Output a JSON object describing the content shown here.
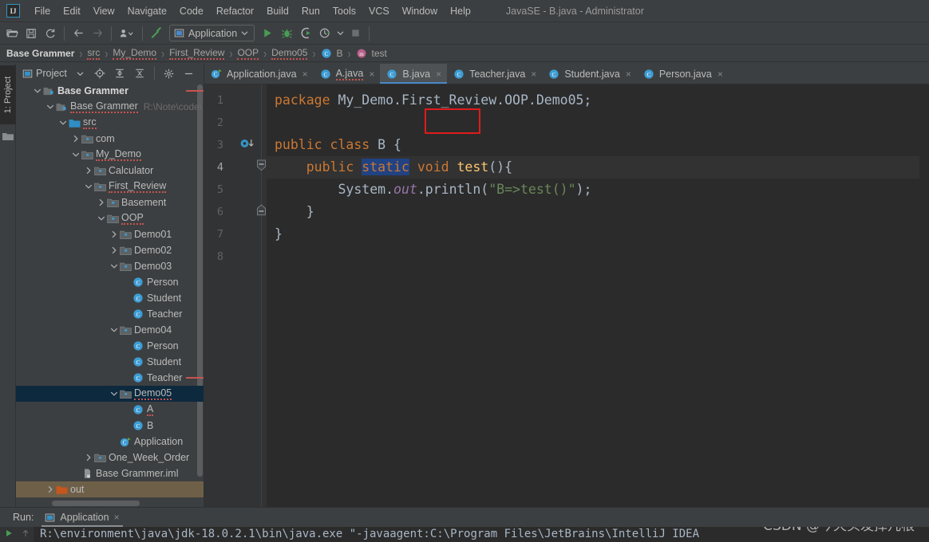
{
  "window": {
    "title": "JavaSE - B.java - Administrator",
    "logo_text": "IJ"
  },
  "menu": {
    "items": [
      {
        "label": "File"
      },
      {
        "label": "Edit"
      },
      {
        "label": "View"
      },
      {
        "label": "Navigate"
      },
      {
        "label": "Code"
      },
      {
        "label": "Refactor"
      },
      {
        "label": "Build"
      },
      {
        "label": "Run"
      },
      {
        "label": "Tools"
      },
      {
        "label": "VCS"
      },
      {
        "label": "Window"
      },
      {
        "label": "Help"
      }
    ]
  },
  "toolbar": {
    "icons": [
      "open-folder-icon",
      "save-icon",
      "sync-icon",
      "back-arrow-icon",
      "forward-arrow-icon",
      "profile-icon",
      "build-hammer-icon"
    ],
    "run_config": "Application",
    "run_icon": "run-icon",
    "debug_icon": "debug-icon",
    "coverage_icon": "run-with-coverage-icon",
    "profiler_icon": "profiler-icon",
    "stop_icon": "stop-icon"
  },
  "breadcrumb": {
    "items": [
      {
        "label": "Base Grammer",
        "style": "bold",
        "icon": ""
      },
      {
        "label": "src",
        "style": "squiggle",
        "icon": ""
      },
      {
        "label": "My_Demo",
        "style": "squiggle",
        "icon": ""
      },
      {
        "label": "First_Review",
        "style": "squiggle",
        "icon": ""
      },
      {
        "label": "OOP",
        "style": "squiggle",
        "icon": ""
      },
      {
        "label": "Demo05",
        "style": "squiggle",
        "icon": ""
      },
      {
        "label": "B",
        "style": "plain",
        "icon": "class-icon"
      },
      {
        "label": "test",
        "style": "plain",
        "icon": "method-icon"
      }
    ],
    "separator": "›"
  },
  "project_panel": {
    "strip_tab": "1: Project",
    "title": "Project",
    "dropdown_icon": "chevron-down-icon",
    "locate_icon": "locate-target-icon",
    "expand_icon": "expand-all-icon",
    "collapse_icon": "collapse-all-icon",
    "settings_icon": "gear-icon",
    "hide_icon": "minimize-icon",
    "tree": [
      {
        "label": "Base Grammer",
        "indent": 1,
        "twist": "down",
        "icon": "module-icon",
        "style": "bold",
        "path": "",
        "state": "normal"
      },
      {
        "label": "Base Grammer",
        "indent": 2,
        "twist": "down",
        "icon": "module-icon",
        "style": "sq",
        "path": "R:\\Note\\code\\",
        "state": "normal"
      },
      {
        "label": "src",
        "indent": 3,
        "twist": "down",
        "icon": "src-folder-icon",
        "style": "sq",
        "path": "",
        "state": "normal"
      },
      {
        "label": "com",
        "indent": 4,
        "twist": "right",
        "icon": "package-icon",
        "style": "normal",
        "path": "",
        "state": "normal"
      },
      {
        "label": "My_Demo",
        "indent": 4,
        "twist": "down",
        "icon": "package-icon",
        "style": "sq",
        "path": "",
        "state": "normal"
      },
      {
        "label": "Calculator",
        "indent": 5,
        "twist": "right",
        "icon": "package-icon",
        "style": "normal",
        "path": "",
        "state": "normal"
      },
      {
        "label": "First_Review",
        "indent": 5,
        "twist": "down",
        "icon": "package-icon",
        "style": "sq",
        "path": "",
        "state": "normal"
      },
      {
        "label": "Basement",
        "indent": 6,
        "twist": "right",
        "icon": "package-icon",
        "style": "normal",
        "path": "",
        "state": "normal"
      },
      {
        "label": "OOP",
        "indent": 6,
        "twist": "down",
        "icon": "package-icon",
        "style": "sq",
        "path": "",
        "state": "normal"
      },
      {
        "label": "Demo01",
        "indent": 7,
        "twist": "right",
        "icon": "package-icon",
        "style": "normal",
        "path": "",
        "state": "normal"
      },
      {
        "label": "Demo02",
        "indent": 7,
        "twist": "right",
        "icon": "package-icon",
        "style": "normal",
        "path": "",
        "state": "normal"
      },
      {
        "label": "Demo03",
        "indent": 7,
        "twist": "down",
        "icon": "package-icon",
        "style": "normal",
        "path": "",
        "state": "normal"
      },
      {
        "label": "Person",
        "indent": 8,
        "twist": "none",
        "icon": "class-icon",
        "style": "normal",
        "path": "",
        "state": "normal"
      },
      {
        "label": "Student",
        "indent": 8,
        "twist": "none",
        "icon": "class-icon",
        "style": "normal",
        "path": "",
        "state": "normal"
      },
      {
        "label": "Teacher",
        "indent": 8,
        "twist": "none",
        "icon": "class-icon",
        "style": "normal",
        "path": "",
        "state": "normal"
      },
      {
        "label": "Demo04",
        "indent": 7,
        "twist": "down",
        "icon": "package-icon",
        "style": "normal",
        "path": "",
        "state": "normal"
      },
      {
        "label": "Person",
        "indent": 8,
        "twist": "none",
        "icon": "class-icon",
        "style": "normal",
        "path": "",
        "state": "normal"
      },
      {
        "label": "Student",
        "indent": 8,
        "twist": "none",
        "icon": "class-icon",
        "style": "normal",
        "path": "",
        "state": "normal"
      },
      {
        "label": "Teacher",
        "indent": 8,
        "twist": "none",
        "icon": "class-icon",
        "style": "normal",
        "path": "",
        "state": "marker"
      },
      {
        "label": "Demo05",
        "indent": 7,
        "twist": "down",
        "icon": "package-icon",
        "style": "sq",
        "path": "",
        "state": "selected"
      },
      {
        "label": "A",
        "indent": 8,
        "twist": "none",
        "icon": "class-icon",
        "style": "sq",
        "path": "",
        "state": "normal"
      },
      {
        "label": "B",
        "indent": 8,
        "twist": "none",
        "icon": "class-icon",
        "style": "normal",
        "path": "",
        "state": "normal"
      },
      {
        "label": "Application",
        "indent": 7,
        "twist": "none",
        "icon": "runnable-class-icon",
        "style": "normal",
        "path": "",
        "state": "normal"
      },
      {
        "label": "One_Week_Order",
        "indent": 5,
        "twist": "right",
        "icon": "package-icon",
        "style": "normal",
        "path": "",
        "state": "normal"
      },
      {
        "label": "Base Grammer.iml",
        "indent": 4,
        "twist": "none",
        "icon": "iml-file-icon",
        "style": "normal",
        "path": "",
        "state": "normal"
      },
      {
        "label": "out",
        "indent": 2,
        "twist": "right",
        "icon": "out-folder-icon",
        "style": "normal",
        "path": "",
        "state": "out-selected"
      }
    ]
  },
  "editor": {
    "tabs": [
      {
        "label": "Application.java",
        "icon": "runnable-class-icon",
        "active": false,
        "squiggle": false,
        "close": "×"
      },
      {
        "label": "A.java",
        "icon": "class-icon",
        "active": false,
        "squiggle": true,
        "close": "×"
      },
      {
        "label": "B.java",
        "icon": "class-icon",
        "active": true,
        "squiggle": false,
        "close": "×"
      },
      {
        "label": "Teacher.java",
        "icon": "class-icon",
        "active": false,
        "squiggle": false,
        "close": "×"
      },
      {
        "label": "Student.java",
        "icon": "class-icon",
        "active": false,
        "squiggle": false,
        "close": "×"
      },
      {
        "label": "Person.java",
        "icon": "class-icon",
        "active": false,
        "squiggle": false,
        "close": "×"
      }
    ],
    "line_numbers": [
      "1",
      "2",
      "3",
      "4",
      "5",
      "6",
      "7",
      "8"
    ],
    "current_line": "4",
    "code_lines": [
      {
        "n": "1",
        "tokens": [
          {
            "t": "package ",
            "c": "kw"
          },
          {
            "t": "My_Demo.First_Review.OOP.Demo05;",
            "c": "plain"
          }
        ]
      },
      {
        "n": "2",
        "tokens": []
      },
      {
        "n": "3",
        "tokens": [
          {
            "t": "public class ",
            "c": "kw"
          },
          {
            "t": "B {",
            "c": "plain"
          }
        ]
      },
      {
        "n": "4",
        "tokens": [
          {
            "t": "    public ",
            "c": "kw"
          },
          {
            "t": "static",
            "c": "sel"
          },
          {
            "t": " void ",
            "c": "kw"
          },
          {
            "t": "test",
            "c": "fn"
          },
          {
            "t": "(){",
            "c": "plain"
          }
        ]
      },
      {
        "n": "5",
        "tokens": [
          {
            "t": "        System.",
            "c": "plain"
          },
          {
            "t": "out",
            "c": "fld"
          },
          {
            "t": ".println(",
            "c": "plain"
          },
          {
            "t": "\"B=>test()\"",
            "c": "str"
          },
          {
            "t": ");",
            "c": "plain"
          }
        ]
      },
      {
        "n": "6",
        "tokens": [
          {
            "t": "    }",
            "c": "plain"
          }
        ]
      },
      {
        "n": "7",
        "tokens": [
          {
            "t": "}",
            "c": "plain"
          }
        ]
      },
      {
        "n": "8",
        "tokens": []
      }
    ],
    "gutter_run_icon": "run-class-gutter-icon",
    "fold_icons": [
      "fold-minus-icon",
      "fold-end-icon"
    ],
    "selected_text": "static"
  },
  "run_panel": {
    "label": "Run:",
    "tab_label": "Application",
    "tab_icon": "console-icon",
    "tab_close": "×",
    "rerun_icon": "rerun-icon",
    "up_icon": "up-arrow-icon",
    "console_line": "R:\\environment\\java\\jdk-18.0.2.1\\bin\\java.exe \"-javaagent:C:\\Program Files\\JetBrains\\IntelliJ IDEA"
  },
  "watermark": "CSDN @今天头发掉几根",
  "colors": {
    "accent_blue": "#4a88c7",
    "selection_blue": "#214283",
    "annotation_red": "#e01b1b",
    "editor_bg": "#2b2b2b",
    "panel_bg": "#3c3f41",
    "keyword_orange": "#cc7832",
    "string_green": "#6a8759",
    "method_yellow": "#ffc66d",
    "field_purple": "#9876aa",
    "tree_selection": "#0d293e",
    "out_selection": "#6e6048"
  }
}
